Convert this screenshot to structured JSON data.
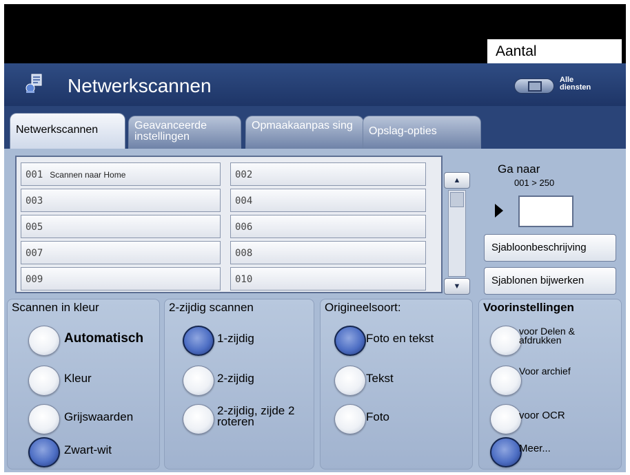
{
  "topbar": {
    "quantity_label": "Aantal"
  },
  "header": {
    "title": "Netwerkscannen",
    "all_services_label": "Alle\ndiensten"
  },
  "tabs": [
    {
      "label": "Netwerkscannen",
      "active": true
    },
    {
      "label": "Geavanceerde instellingen",
      "active": false
    },
    {
      "label": "Opmaakaanpas sing",
      "active": false
    },
    {
      "label": "Opslag-opties",
      "active": false
    }
  ],
  "templates": [
    {
      "number": "001",
      "name": "Scannen naar Home"
    },
    {
      "number": "002",
      "name": ""
    },
    {
      "number": "003",
      "name": ""
    },
    {
      "number": "004",
      "name": ""
    },
    {
      "number": "005",
      "name": ""
    },
    {
      "number": "006",
      "name": ""
    },
    {
      "number": "007",
      "name": ""
    },
    {
      "number": "008",
      "name": ""
    },
    {
      "number": "009",
      "name": ""
    },
    {
      "number": "010",
      "name": ""
    }
  ],
  "goto": {
    "label": "Ga naar",
    "range": "001 > 250",
    "value": ""
  },
  "side_buttons": {
    "description": "Sjabloonbeschrijving",
    "update": "Sjablonen bijwerken"
  },
  "groups": {
    "color": {
      "title": "Scannen in kleur",
      "options": [
        {
          "label": "Automatisch",
          "selected": false,
          "bold": true
        },
        {
          "label": "Kleur",
          "selected": false
        },
        {
          "label": "Grijswaarden",
          "selected": false
        },
        {
          "label": "Zwart-wit",
          "selected": true
        }
      ]
    },
    "sides": {
      "title": "2-zijdig scannen",
      "options": [
        {
          "label": "1-zijdig",
          "selected": true
        },
        {
          "label": "2-zijdig",
          "selected": false
        },
        {
          "label": "2-zijdig, zijde 2 roteren",
          "selected": false
        }
      ]
    },
    "original": {
      "title": "Origineelsoort:",
      "options": [
        {
          "label": "Foto en tekst",
          "selected": true
        },
        {
          "label": "Tekst",
          "selected": false
        },
        {
          "label": "Foto",
          "selected": false
        }
      ]
    },
    "presets": {
      "title": "Voorinstellingen",
      "options": [
        {
          "label": "voor Delen & afdrukken",
          "selected": false
        },
        {
          "label": "Voor archief",
          "selected": false
        },
        {
          "label": "voor OCR",
          "selected": false
        },
        {
          "label": "Meer...",
          "selected": true
        }
      ]
    }
  },
  "icons": {
    "app": "network-scan-icon",
    "all_services": "all-services-icon",
    "goto_arrow": "arrow-right-icon",
    "scroll_up": "scroll-up-icon",
    "scroll_down": "scroll-down-icon"
  },
  "colors": {
    "header_bg": "#1e3567",
    "panel_bg": "#a9bbd5",
    "radio_selected": "#4e6fc4"
  }
}
